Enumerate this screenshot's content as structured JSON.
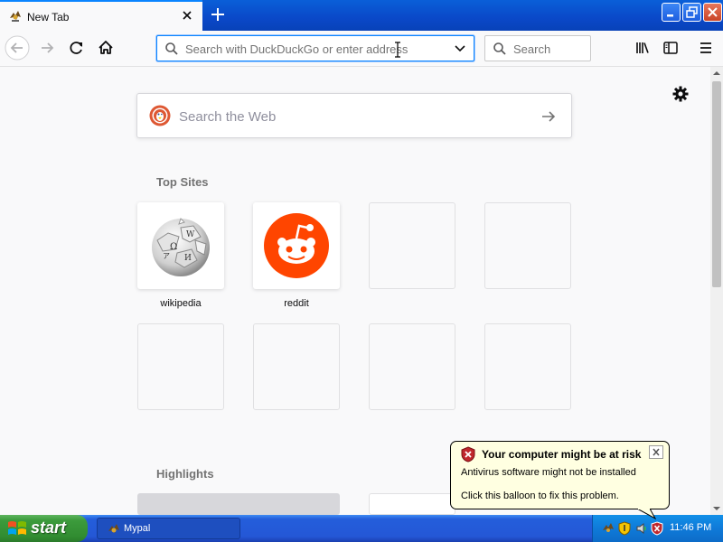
{
  "browser": {
    "tab": {
      "title": "New Tab"
    },
    "urlbar": {
      "placeholder": "Search with DuckDuckGo or enter address",
      "value": ""
    },
    "searchbar": {
      "placeholder": "Search",
      "value": ""
    }
  },
  "newtab": {
    "websearch": {
      "placeholder": "Search the Web"
    },
    "top_sites_title": "Top Sites",
    "top_sites": [
      {
        "label": "wikipedia",
        "icon": "wikipedia-globe-icon"
      },
      {
        "label": "reddit",
        "icon": "reddit-alien-icon"
      }
    ],
    "highlights_title": "Highlights"
  },
  "balloon": {
    "title": "Your computer might be at risk",
    "line1": "Antivirus software might not be installed",
    "line2": "Click this balloon to fix this problem."
  },
  "taskbar": {
    "start_label": "start",
    "task_label": "Mypal",
    "time": "11:46 PM"
  },
  "colors": {
    "accent": "#0a84ff",
    "reddit": "#ff4500",
    "duckduckgo": "#de5833",
    "xp_blue": "#245edb",
    "xp_green": "#3c9b3c",
    "balloon_bg": "#ffffe1"
  }
}
